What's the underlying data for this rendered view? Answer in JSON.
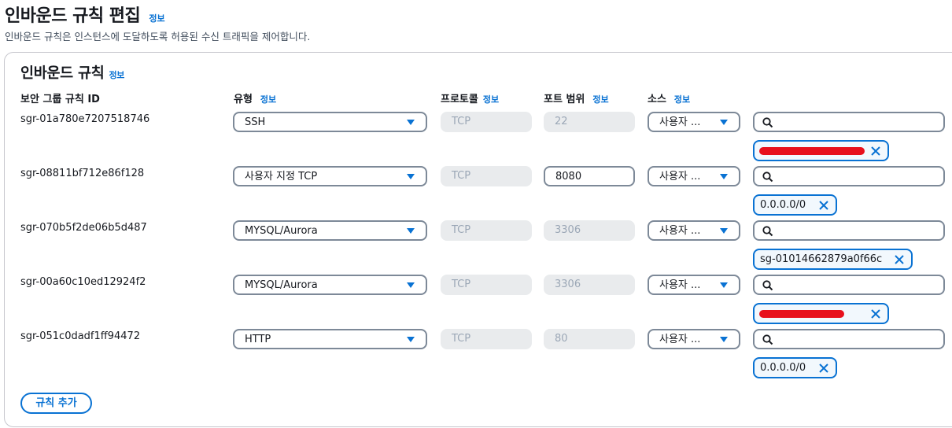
{
  "header": {
    "title": "인바운드 규칙 편집",
    "info": "정보",
    "description": "인바운드 규칙은 인스턴스에 도달하도록 허용된 수신 트래픽을 제어합니다."
  },
  "panel": {
    "title": "인바운드 규칙",
    "info": "정보",
    "columns": {
      "rule_id": "보안 그룹 규칙 ID",
      "type": "유형",
      "protocol": "프로토콜",
      "port_range": "포트 범위",
      "source": "소스",
      "info": "정보"
    },
    "rows": [
      {
        "rule_id": "sgr-01a780e7207518746",
        "type": "SSH",
        "protocol": "TCP",
        "port": "22",
        "source": "사용자 ...",
        "token": ""
      },
      {
        "rule_id": "sgr-08811bf712e86f128",
        "type": "사용자 지정 TCP",
        "protocol": "TCP",
        "port": "8080",
        "source": "사용자 ...",
        "token": "0.0.0.0/0"
      },
      {
        "rule_id": "sgr-070b5f2de06b5d487",
        "type": "MYSQL/Aurora",
        "protocol": "TCP",
        "port": "3306",
        "source": "사용자 ...",
        "token": "sg-01014662879a0f66c"
      },
      {
        "rule_id": "sgr-00a60c10ed12924f2",
        "type": "MYSQL/Aurora",
        "protocol": "TCP",
        "port": "3306",
        "source": "사용자 ...",
        "token": ""
      },
      {
        "rule_id": "sgr-051c0dadf1ff94472",
        "type": "HTTP",
        "protocol": "TCP",
        "port": "80",
        "source": "사용자 ...",
        "token": "0.0.0.0/0"
      }
    ],
    "add_rule_label": "규칙 추가"
  },
  "icons": {
    "search": "search-icon",
    "remove": "close-icon",
    "dropdown": "caret-down-icon"
  },
  "colors": {
    "accent": "#0972d3",
    "border": "#7d8998",
    "disabled_bg": "#e9ebed",
    "redaction": "#e8101c"
  }
}
